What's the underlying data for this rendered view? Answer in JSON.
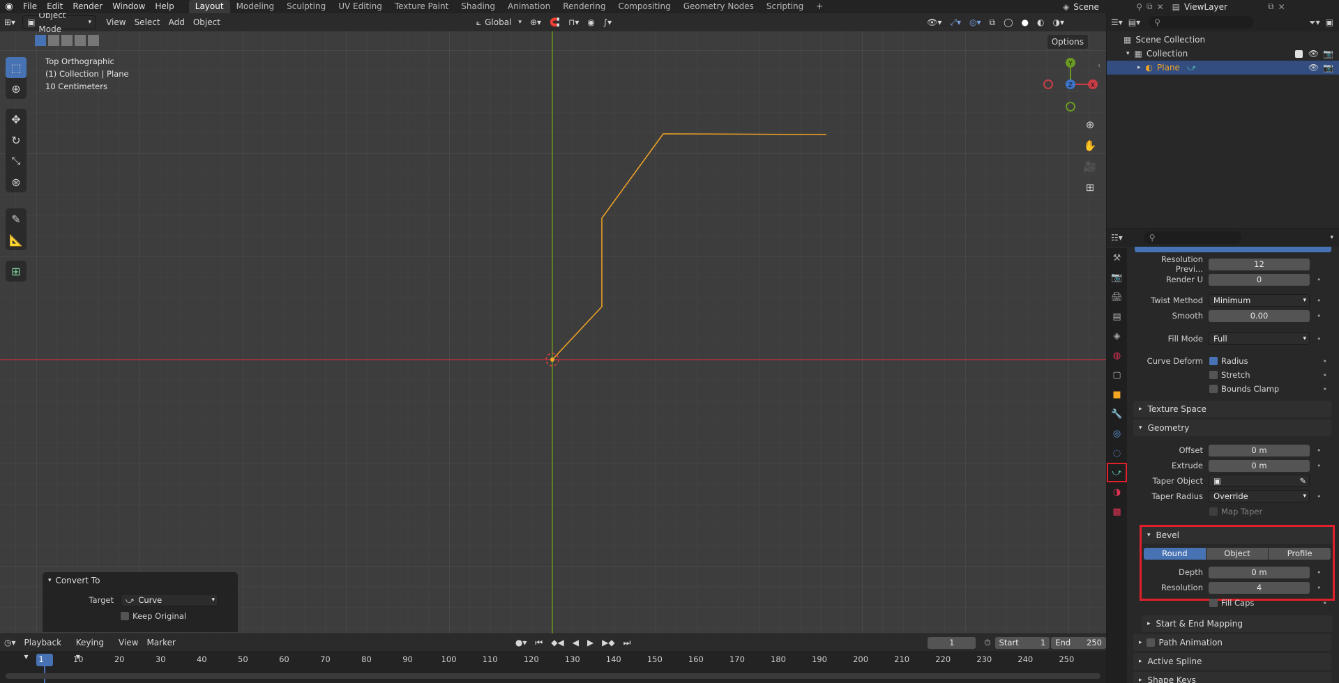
{
  "topbar": {
    "menus": [
      "File",
      "Edit",
      "Render",
      "Window",
      "Help"
    ],
    "workspaces": [
      "Layout",
      "Modeling",
      "Sculpting",
      "UV Editing",
      "Texture Paint",
      "Shading",
      "Animation",
      "Rendering",
      "Compositing",
      "Geometry Nodes",
      "Scripting"
    ],
    "active_workspace": "Layout",
    "scene": "Scene",
    "view_layer": "ViewLayer"
  },
  "viewport": {
    "mode": "Object Mode",
    "menus": [
      "View",
      "Select",
      "Add",
      "Object"
    ],
    "transform_orientation": "Global",
    "options_label": "Options",
    "overlay": {
      "view_name": "Top Orthographic",
      "collection_line": "(1) Collection | Plane",
      "scale_line": "10 Centimeters"
    },
    "gizmo": {
      "y": "Y",
      "z": "Z",
      "x": "X"
    },
    "curve_color": "#f5a623",
    "x_axis_color": "#b5333d",
    "y_axis_color": "#6a9a23"
  },
  "convert_panel": {
    "title": "Convert To",
    "target_label": "Target",
    "target_value": "Curve",
    "keep_original": "Keep Original"
  },
  "outliner": {
    "scene_collection": "Scene Collection",
    "collection": "Collection",
    "object": "Plane"
  },
  "properties": {
    "resolution_preview_label": "Resolution Previ...",
    "resolution_preview": "12",
    "render_u_label": "Render U",
    "render_u": "0",
    "twist_method_label": "Twist Method",
    "twist_method": "Minimum",
    "smooth_label": "Smooth",
    "smooth": "0.00",
    "fill_mode_label": "Fill Mode",
    "fill_mode": "Full",
    "curve_deform_label": "Curve Deform",
    "radius": "Radius",
    "stretch": "Stretch",
    "bounds_clamp": "Bounds Clamp",
    "texture_space": "Texture Space",
    "geometry": "Geometry",
    "offset_label": "Offset",
    "offset": "0 m",
    "extrude_label": "Extrude",
    "extrude": "0 m",
    "taper_object_label": "Taper Object",
    "taper_radius_label": "Taper Radius",
    "taper_radius": "Override",
    "map_taper": "Map Taper",
    "bevel": "Bevel",
    "bevel_modes": [
      "Round",
      "Object",
      "Profile"
    ],
    "depth_label": "Depth",
    "depth": "0 m",
    "resolution_label": "Resolution",
    "resolution": "4",
    "fill_caps": "Fill Caps",
    "start_end_mapping": "Start & End Mapping",
    "path_animation": "Path Animation",
    "active_spline": "Active Spline",
    "shape_keys": "Shape Keys"
  },
  "timeline": {
    "menus": [
      "Playback",
      "Keying",
      "View",
      "Marker"
    ],
    "current_frame": "1",
    "start_label": "Start",
    "start": "1",
    "end_label": "End",
    "end": "250",
    "ruler": [
      "1",
      "10",
      "20",
      "30",
      "40",
      "50",
      "60",
      "70",
      "80",
      "90",
      "100",
      "110",
      "120",
      "130",
      "140",
      "150",
      "160",
      "170",
      "180",
      "190",
      "200",
      "210",
      "220",
      "230",
      "240",
      "250"
    ]
  }
}
